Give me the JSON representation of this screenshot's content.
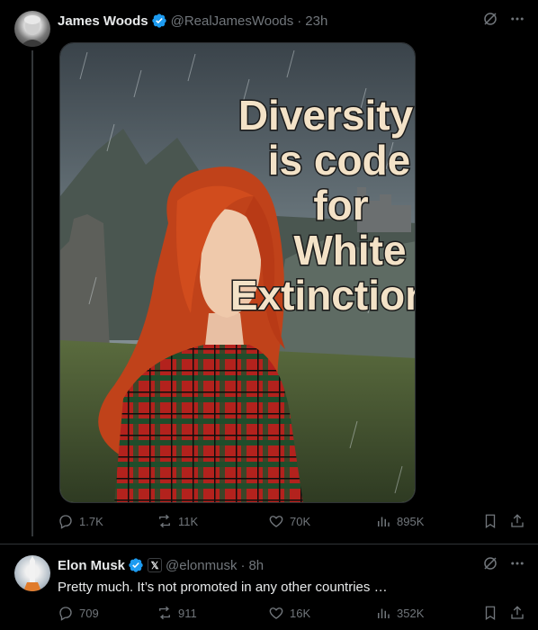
{
  "colors": {
    "background": "#000000",
    "text_primary": "#e7e9ea",
    "text_secondary": "#71767b",
    "verified_blue": "#1d9bf0",
    "divider": "#2f3336"
  },
  "posts": [
    {
      "author_name": "James Woods",
      "handle": "@RealJamesWoods",
      "separator": "·",
      "time": "23h",
      "verified": true,
      "media": {
        "overlay_lines": [
          "Diversity",
          "is code",
          "for",
          "White",
          "Extinction"
        ]
      },
      "stats": {
        "replies": "1.7K",
        "reposts": "11K",
        "likes": "70K",
        "views": "895K"
      },
      "icons": {
        "grok": "grok-icon",
        "more": "more-icon"
      }
    },
    {
      "author_name": "Elon Musk",
      "handle": "@elonmusk",
      "separator": "·",
      "time": "8h",
      "verified": true,
      "affiliate_badge": "𝕏",
      "text": "Pretty much. It’s not promoted in any other countries …",
      "stats": {
        "replies": "709",
        "reposts": "911",
        "likes": "16K",
        "views": "352K"
      },
      "icons": {
        "grok": "grok-icon",
        "more": "more-icon"
      }
    }
  ]
}
